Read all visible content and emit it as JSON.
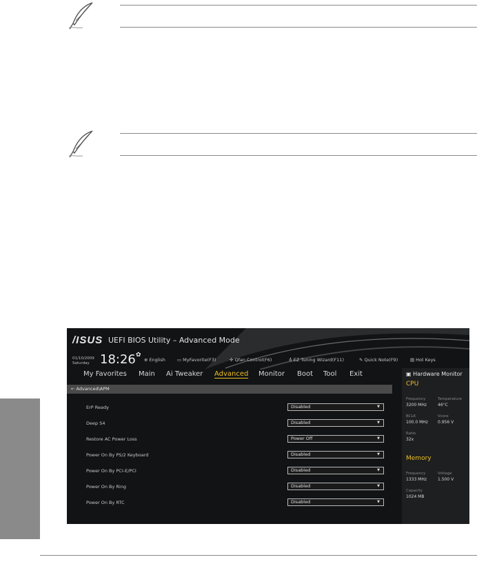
{
  "bios": {
    "logo": "/ISUS",
    "title": "UEFI BIOS Utility – Advanced Mode",
    "date": "01/10/2009",
    "day": "Saturday",
    "time": "18:26",
    "toolbar": [
      {
        "icon": "globe-icon",
        "glyph": "⊕",
        "label": "English"
      },
      {
        "icon": "favorite-icon",
        "glyph": "▭",
        "label": "MyFavorite(F3)"
      },
      {
        "icon": "fan-icon",
        "glyph": "✣",
        "label": "Qfan Control(F6)"
      },
      {
        "icon": "bulb-icon",
        "glyph": "♁",
        "label": "EZ Tuning Wizard(F11)"
      },
      {
        "icon": "note-icon",
        "glyph": "✎",
        "label": "Quick Note(F9)"
      },
      {
        "icon": "keyboard-icon",
        "glyph": "▤",
        "label": "Hot Keys"
      }
    ],
    "menu": [
      "My Favorites",
      "Main",
      "Ai Tweaker",
      "Advanced",
      "Monitor",
      "Boot",
      "Tool",
      "Exit"
    ],
    "active_menu": "Advanced",
    "breadcrumb": "← Advanced\\APM",
    "settings": [
      {
        "label": "ErP Ready",
        "value": "Disabled"
      },
      {
        "label": "Deep S4",
        "value": "Disabled"
      },
      {
        "label": "Restore AC Power Loss",
        "value": "Power Off"
      },
      {
        "label": "Power On By PS/2 Keyboard",
        "value": "Disabled"
      },
      {
        "label": "Power On By PCI-E/PCI",
        "value": "Disabled"
      },
      {
        "label": "Power On By Ring",
        "value": "Disabled"
      },
      {
        "label": "Power On By RTC",
        "value": "Disabled"
      }
    ],
    "hardware_monitor": {
      "title": "Hardware Monitor",
      "cpu": {
        "heading": "CPU",
        "frequency_label": "Frequency",
        "frequency": "3200 MHz",
        "temperature_label": "Temperature",
        "temperature": "46°C",
        "bclk_label": "BCLK",
        "bclk": "100.0 MHz",
        "core_voltage_label": "Vcore",
        "core_voltage": "0.956 V",
        "ratio_label": "Ratio",
        "ratio": "32x"
      },
      "memory": {
        "heading": "Memory",
        "frequency_label": "Frequency",
        "frequency": "1333 MHz",
        "voltage_label": "Voltage",
        "voltage": "1.500 V",
        "capacity_label": "Capacity",
        "capacity": "1024 MB"
      }
    }
  }
}
